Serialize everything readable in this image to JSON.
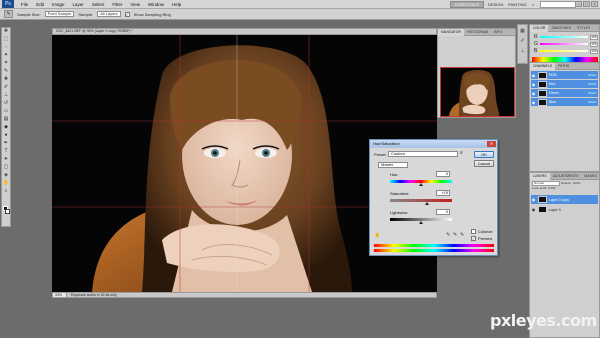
{
  "menubar": {
    "app_logo": "Ps",
    "items": [
      "File",
      "Edit",
      "Image",
      "Layer",
      "Select",
      "Filter",
      "View",
      "Window",
      "Help"
    ],
    "workspace_button": "ESSENTIALS",
    "workspace_items": [
      "DESIGN",
      "PAINTING",
      "»"
    ],
    "window_controls": [
      "–",
      "□",
      "×"
    ]
  },
  "options_bar": {
    "sample_size_label": "Sample Size:",
    "sample_size_value": "Point Sample",
    "sample_label": "Sample:",
    "sample_value": "All Layers",
    "show_ring_checked": "✓",
    "show_ring_label": "Show Sampling Ring"
  },
  "document": {
    "tab_title": "DSC_4621.NEF @ 33% (Layer 0 copy, RGB/8*) *",
    "zoom": "33%",
    "status_info": "Exposure works in 32-bit only"
  },
  "navigator_panel": {
    "tabs": [
      "NAVIGATOR",
      "HISTOGRAM",
      "INFO"
    ]
  },
  "color_panel": {
    "tabs": [
      "COLOR",
      "SWATCHES",
      "STYLES"
    ],
    "sliders": [
      {
        "label": "R",
        "value": "255"
      },
      {
        "label": "G",
        "value": "255"
      },
      {
        "label": "B",
        "value": "255"
      }
    ]
  },
  "channels_panel": {
    "tabs": [
      "CHANNELS",
      "PATHS"
    ],
    "rows": [
      {
        "name": "RGB",
        "shortcut": "Ctrl+2"
      },
      {
        "name": "Red",
        "shortcut": "Ctrl+3"
      },
      {
        "name": "Green",
        "shortcut": "Ctrl+4"
      },
      {
        "name": "Blue",
        "shortcut": "Ctrl+5"
      }
    ]
  },
  "layers_panel": {
    "tabs": [
      "LAYERS",
      "ADJUSTMENTS",
      "MASKS"
    ],
    "blend_mode": "Normal",
    "opacity_label": "Opacity:",
    "opacity": "100%",
    "lock_label": "Lock:",
    "fill_label": "Fill:",
    "fill": "100%",
    "layers": [
      {
        "name": "Layer 0 copy",
        "selected": true
      },
      {
        "name": "Layer 0",
        "selected": false
      }
    ]
  },
  "dialog": {
    "title": "Hue/Saturation",
    "preset_label": "Preset:",
    "preset_value": "Custom",
    "channel_value": "Master",
    "hue_label": "Hue:",
    "hue_value": "0",
    "saturation_label": "Saturation:",
    "saturation_value": "+19",
    "lightness_label": "Lightness:",
    "lightness_value": "0",
    "ok_label": "OK",
    "cancel_label": "Cancel",
    "colorize_label": "Colorize",
    "preview_label": "Preview",
    "preview_checked": "✓"
  },
  "watermark": "pxleyes.com"
}
